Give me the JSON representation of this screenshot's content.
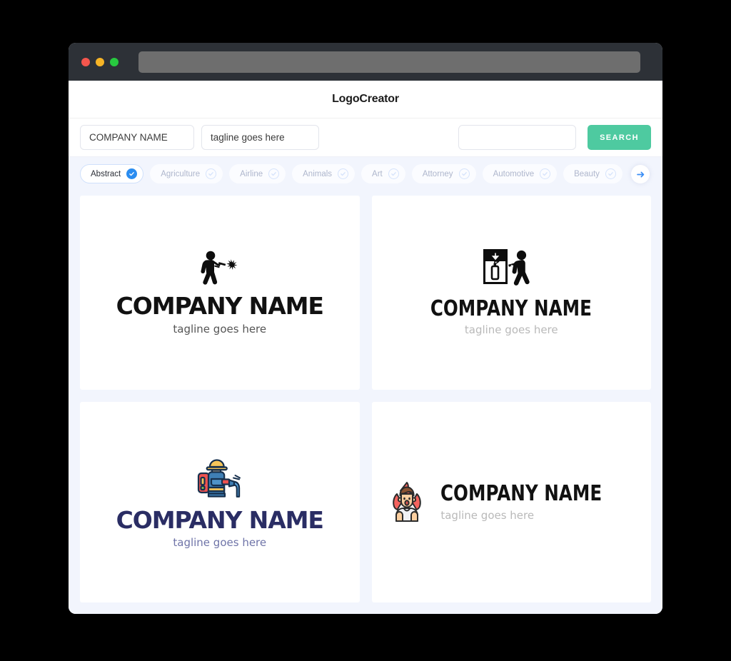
{
  "window": {
    "traffic_lights": [
      "close-red",
      "minimize-yellow",
      "maximize-green"
    ],
    "url_value": ""
  },
  "header": {
    "app_title": "LogoCreator"
  },
  "search": {
    "company_value": "COMPANY NAME",
    "company_placeholder": "COMPANY NAME",
    "tagline_value": "tagline goes here",
    "tagline_placeholder": "tagline goes here",
    "keyword_value": "",
    "keyword_placeholder": "",
    "search_label": "SEARCH"
  },
  "categories": {
    "next_arrow_label": "→",
    "items": [
      {
        "label": "Abstract",
        "selected": true
      },
      {
        "label": "Agriculture",
        "selected": false
      },
      {
        "label": "Airline",
        "selected": false
      },
      {
        "label": "Animals",
        "selected": false
      },
      {
        "label": "Art",
        "selected": false
      },
      {
        "label": "Attorney",
        "selected": false
      },
      {
        "label": "Automotive",
        "selected": false
      },
      {
        "label": "Beauty",
        "selected": false
      }
    ]
  },
  "results": {
    "cards": [
      {
        "icon": "shooter-silhouette-icon",
        "layout": "stacked",
        "name": "COMPANY NAME",
        "tagline": "tagline goes here",
        "name_style": "style-heavy",
        "tagline_style": "tag-gray"
      },
      {
        "icon": "fire-extinguisher-sign-icon",
        "layout": "stacked",
        "name": "COMPANY NAME",
        "tagline": "tagline goes here",
        "name_style": "style-condensed",
        "tagline_style": "tag-light"
      },
      {
        "icon": "firefighter-hose-icon",
        "layout": "stacked",
        "name": "COMPANY NAME",
        "tagline": "tagline goes here",
        "name_style": "style-navy",
        "tagline_style": "tag-navy"
      },
      {
        "icon": "flaming-person-icon",
        "layout": "horizontal",
        "name": "COMPANY NAME",
        "tagline": "tagline goes here",
        "name_style": "style-condensed",
        "tagline_style": "tag-light"
      }
    ]
  },
  "colors": {
    "accent_green": "#4ecaa0",
    "accent_blue": "#2b8df0",
    "page_background": "#f2f5fd",
    "titlebar": "#2d3137",
    "logo_navy": "#2a2d64"
  }
}
